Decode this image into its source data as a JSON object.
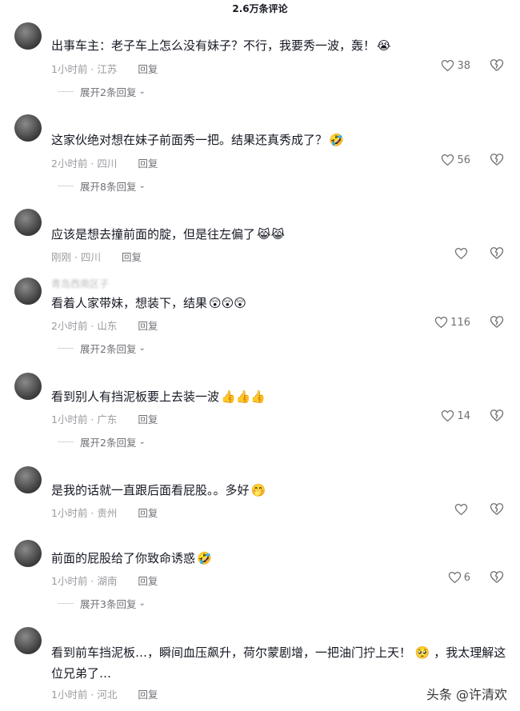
{
  "header": {
    "title": "2.6万条评论"
  },
  "comments": [
    {
      "text": "出事车主：老子车上怎么没有妹子？不行，我要秀一波，轰！",
      "emoji": "😭",
      "time": "1小时前",
      "location": "江苏",
      "reply": "回复",
      "likes": "38",
      "expand": "展开2条回复",
      "username": ""
    },
    {
      "text": "这家伙绝对想在妹子前面秀一把。结果还真秀成了？",
      "emoji": "🤣",
      "time": "2小时前",
      "location": "四川",
      "reply": "回复",
      "likes": "56",
      "expand": "展开8条回复",
      "username": ""
    },
    {
      "text": "应该是想去撞前面的腚，但是往左偏了",
      "emoji": "😹😹",
      "time": "刚刚",
      "location": "四川",
      "reply": "回复",
      "likes": "",
      "expand": "",
      "username": ""
    },
    {
      "text": "看着人家带妹，想装下，结果",
      "emoji": "😲😲😲",
      "time": "2小时前",
      "location": "山东",
      "reply": "回复",
      "likes": "116",
      "expand": "展开2条回复",
      "username": "青岛西南区子"
    },
    {
      "text": "看到别人有挡泥板要上去装一波",
      "emoji": "👍👍👍",
      "time": "1小时前",
      "location": "广东",
      "reply": "回复",
      "likes": "14",
      "expand": "展开2条回复",
      "username": ""
    },
    {
      "text": "是我的话就一直跟后面看屁股。。多好",
      "emoji": "🤭",
      "time": "1小时前",
      "location": "贵州",
      "reply": "回复",
      "likes": "",
      "expand": "",
      "username": ""
    },
    {
      "text": "前面的屁股给了你致命诱惑",
      "emoji": "🤣",
      "time": "1小时前",
      "location": "湖南",
      "reply": "回复",
      "likes": "6",
      "expand": "展开3条回复",
      "username": ""
    },
    {
      "text": "看到前车挡泥板…，瞬间血压飙升，荷尔蒙剧增，一把油门拧上天！ 🥺 ，我太理解这位兄弟了…",
      "emoji": "",
      "time": "1小时前",
      "location": "河北",
      "reply": "回复",
      "likes": "",
      "expand": "",
      "username": ""
    }
  ],
  "watermark": "头条 @许清欢",
  "colors": {
    "text": "#161823",
    "meta": "#9a9ba0",
    "accent": "#6f7076"
  }
}
